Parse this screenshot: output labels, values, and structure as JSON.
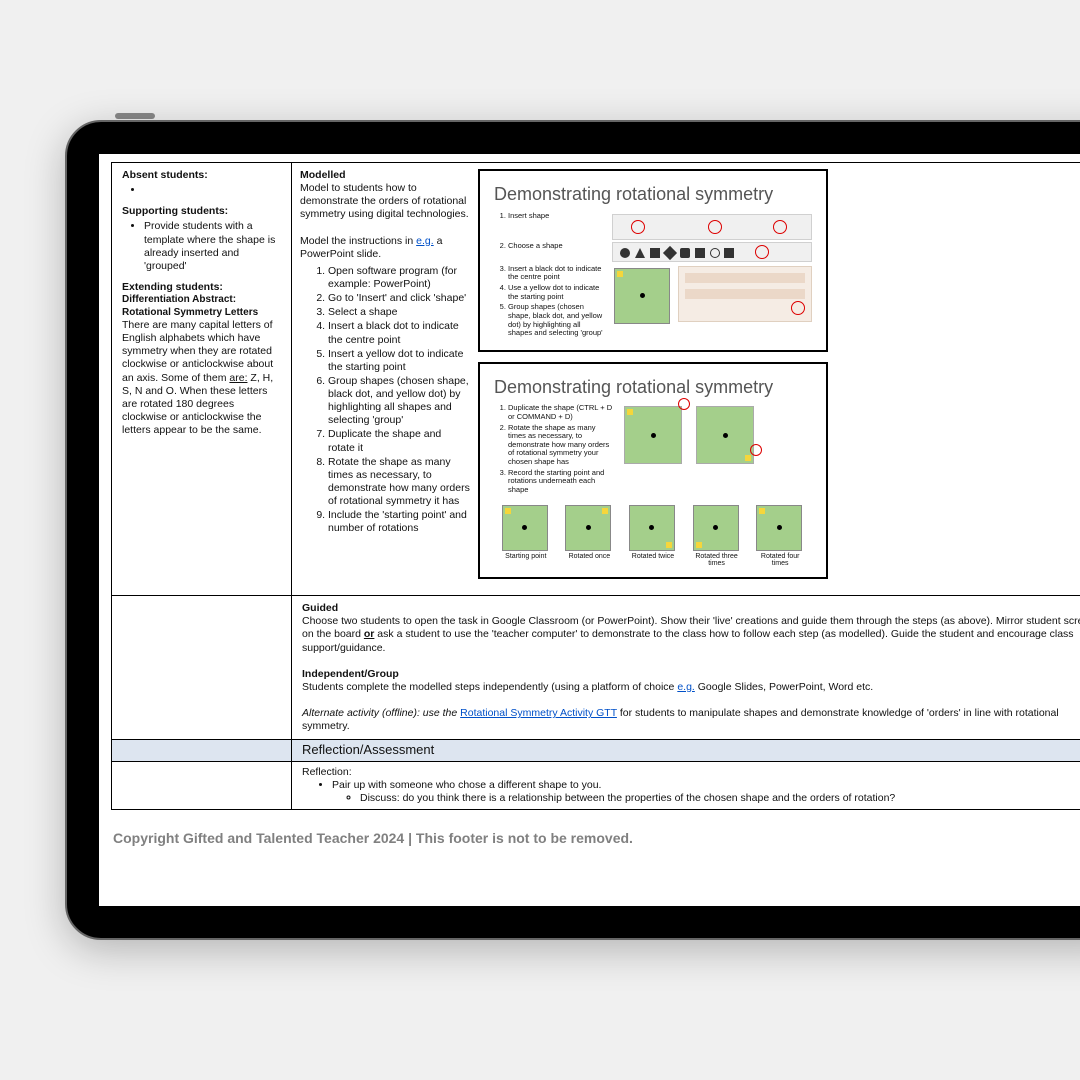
{
  "sidebar": {
    "absent_h": "Absent students:",
    "supporting_h": "Supporting students:",
    "supporting_item": "Provide students with a template where the shape is already inserted and 'grouped'",
    "extending_h": "Extending students:",
    "diff_title": "Differentiation Abstract: Rotational Symmetry Letters",
    "diff_body_a": "There are many capital letters of English alphabets which have symmetry when they are rotated clockwise or anticlockwise about an axis. Some of them ",
    "are_label": "are:",
    "diff_body_b": " Z, H, S, N and O. When these letters are rotated 180 degrees clockwise or anticlockwise the letters appear to be the same."
  },
  "activity": {
    "modelled_h": "Modelled",
    "modelled_intro": "Model to students how to demonstrate the orders of rotational symmetry using digital technologies.",
    "model_instr_a": "Model the instructions in ",
    "eg": "e.g.",
    "model_instr_b": " a PowerPoint slide.",
    "steps": [
      "Open software program (for example: PowerPoint)",
      "Go to 'Insert' and click 'shape'",
      "Select a shape",
      "Insert a black dot to indicate the centre point",
      "Insert a yellow dot to indicate the starting point",
      "Group shapes (chosen shape, black dot, and yellow dot) by highlighting all shapes and selecting 'group'",
      "Duplicate the shape and rotate it",
      "Rotate the shape as many times as necessary, to demonstrate how many orders of rotational symmetry it has",
      "Include the 'starting point' and number of rotations"
    ],
    "fig_title": "Demonstrating rotational symmetry",
    "fig1_steps": [
      "Insert shape",
      "Choose a shape",
      "Insert a black dot to indicate the centre point",
      "Use a yellow dot to indicate the starting point",
      "Group shapes (chosen shape, black dot, and yellow dot) by highlighting all shapes and selecting 'group'"
    ],
    "fig2_steps": [
      "Duplicate the shape (CTRL + D or COMMAND + D)",
      "Rotate the shape as many times as necessary, to demonstrate how many orders of rotational symmetry your chosen shape has",
      "Record the starting point and rotations underneath each shape"
    ],
    "caps": [
      "Starting point",
      "Rotated once",
      "Rotated twice",
      "Rotated three times",
      "Rotated four times"
    ],
    "guided_h": "Guided",
    "guided_a": "Choose two students to open the task in Google Classroom (or PowerPoint). Show their 'live' creations and guide them through the steps (as above). Mirror student screens on the board ",
    "or": "or",
    "guided_b": " ask a student to use the 'teacher computer' to demonstrate to the class how to follow each step (as modelled). Guide the student and encourage class support/guidance.",
    "indep_h": "Independent/Group",
    "indep_a": "Students complete the modelled steps independently (using a platform of choice ",
    "indep_b": " Google Slides, PowerPoint, Word etc.",
    "alt_a": "Alternate activity (offline): use the ",
    "alt_link": "Rotational Symmetry Activity GTT",
    "alt_b": " for students to manipulate shapes and demonstrate knowledge of 'orders' in line with rotational symmetry."
  },
  "reflection": {
    "bar": "Reflection/Assessment",
    "h": "Reflection:",
    "pair": "Pair up with someone who chose a different shape to you.",
    "discuss": "Discuss: do you think there is a relationship between the properties of the chosen shape and the orders of rotation?"
  },
  "footer": "Copyright Gifted and Talented Teacher 2024 | This footer is not to be removed."
}
